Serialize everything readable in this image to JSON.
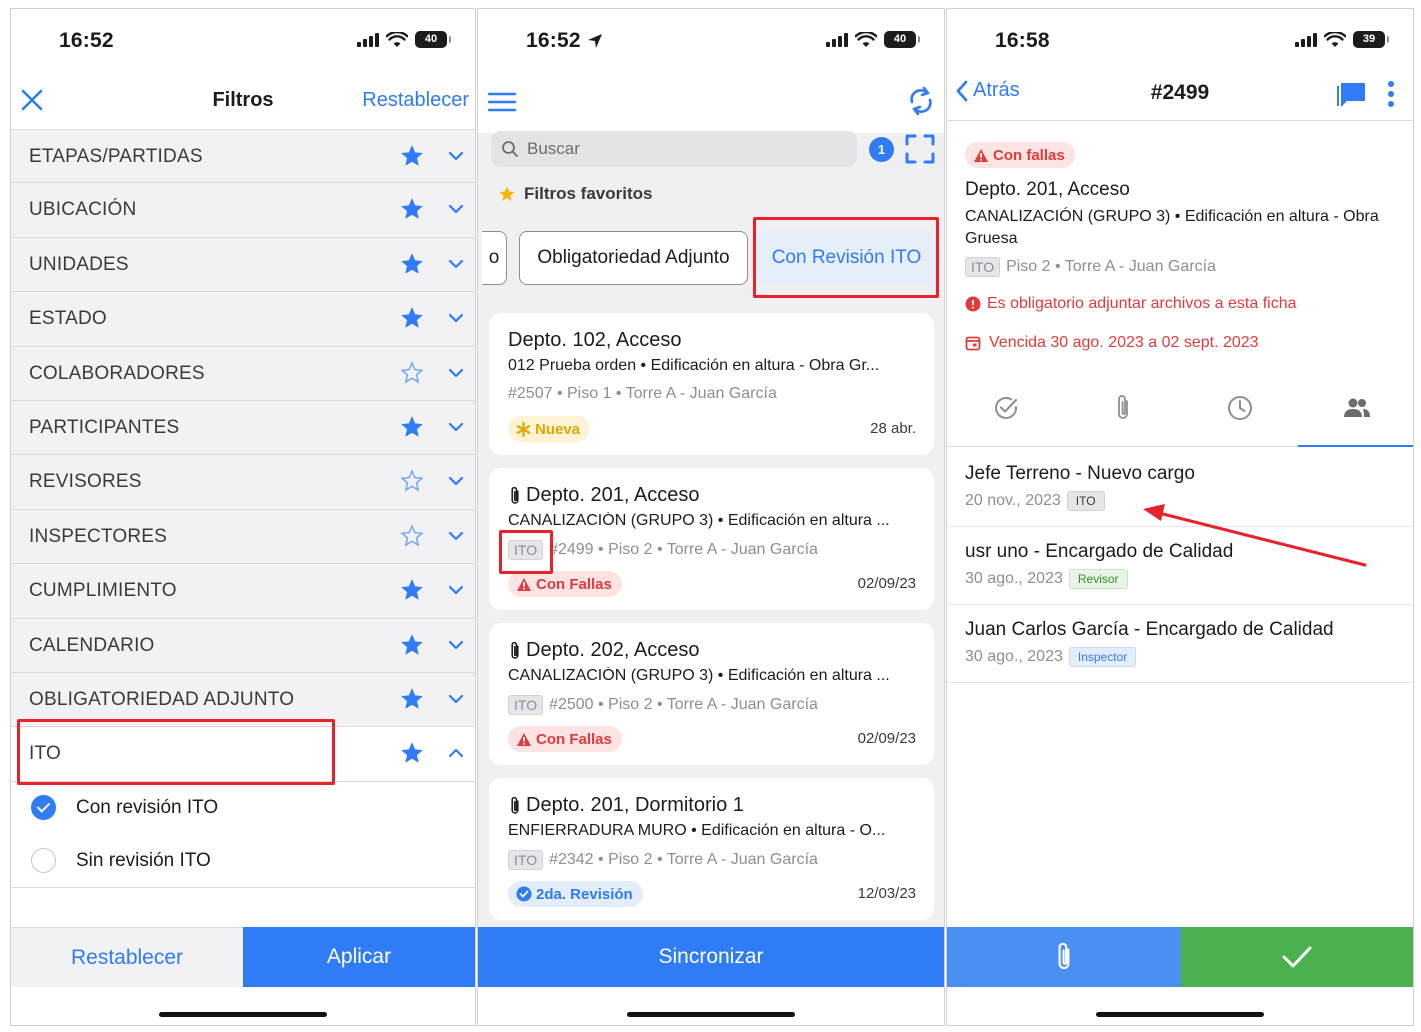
{
  "phones": [
    {
      "status": {
        "time": "16:52",
        "battery": "40"
      },
      "header": {
        "title": "Filtros",
        "reset_label": "Restablecer"
      },
      "filters": [
        {
          "label": "ETAPAS/PARTIDAS",
          "favorite": true
        },
        {
          "label": "UBICACIÓN",
          "favorite": true
        },
        {
          "label": "UNIDADES",
          "favorite": true
        },
        {
          "label": "ESTADO",
          "favorite": true
        },
        {
          "label": "COLABORADORES",
          "favorite": false
        },
        {
          "label": "PARTICIPANTES",
          "favorite": true
        },
        {
          "label": "REVISORES",
          "favorite": false
        },
        {
          "label": "INSPECTORES",
          "favorite": false
        },
        {
          "label": "CUMPLIMIENTO",
          "favorite": true
        },
        {
          "label": "CALENDARIO",
          "favorite": true
        },
        {
          "label": "OBLIGATORIEDAD ADJUNTO",
          "favorite": true
        },
        {
          "label": "ITO",
          "favorite": true,
          "expanded": true
        }
      ],
      "ito_options": [
        {
          "label": "Con revisión ITO",
          "checked": true
        },
        {
          "label": "Sin revisión ITO",
          "checked": false
        }
      ],
      "footer": {
        "reset_label": "Restablecer",
        "apply_label": "Aplicar"
      }
    },
    {
      "status": {
        "time": "16:52",
        "battery": "40"
      },
      "search": {
        "placeholder": "Buscar"
      },
      "filter_count": "1",
      "favorites_title": "Filtros favoritos",
      "chips": [
        {
          "label": "o",
          "active": false
        },
        {
          "label": "Obligatoriedad Adjunto",
          "active": false
        },
        {
          "label": "Con Revisión ITO",
          "active": true
        }
      ],
      "cards": [
        {
          "title": "Depto. 102, Acceso",
          "subtitle": "012 Prueba orden • Edificación en altura - Obra Gr...",
          "tag": "",
          "meta": "#2507 • Piso 1 • Torre A - Juan García",
          "badge": "Nueva",
          "date": "28 abr.",
          "attachment": false
        },
        {
          "title": "Depto. 201, Acceso",
          "subtitle": "CANALIZACIÓN (GRUPO 3) • Edificación en altura ...",
          "tag": "ITO",
          "meta": "#2499 • Piso 2 • Torre A - Juan García",
          "badge": "Con Fallas",
          "date": "02/09/23",
          "attachment": true
        },
        {
          "title": "Depto. 202, Acceso",
          "subtitle": "CANALIZACIÓN (GRUPO 3) • Edificación en altura ...",
          "tag": "ITO",
          "meta": "#2500 • Piso 2 • Torre A - Juan García",
          "badge": "Con Fallas",
          "date": "02/09/23",
          "attachment": true
        },
        {
          "title": "Depto. 201, Dormitorio 1",
          "subtitle": "ENFIERRADURA MURO • Edificación en altura - O...",
          "tag": "ITO",
          "meta": "#2342 • Piso 2 • Torre A - Juan García",
          "badge": "2da. Revisión",
          "date": "12/03/23",
          "attachment": true
        }
      ],
      "footer": {
        "sync_label": "Sincronizar"
      }
    },
    {
      "status": {
        "time": "16:58",
        "battery": "39"
      },
      "header": {
        "back_label": "Atrás",
        "title": "#2499"
      },
      "detail": {
        "status_pill": "Con fallas",
        "location": "Depto. 201, Acceso",
        "description": "CANALIZACIÓN (GRUPO 3) • Edificación en altura - Obra Gruesa",
        "tag": "ITO",
        "meta": "Piso 2 • Torre A - Juan García",
        "warning": "Es obligatorio adjuntar archivos a esta ficha",
        "due": "Vencida 30 ago. 2023 a 02 sept. 2023"
      },
      "participants": [
        {
          "name": "Jefe Terreno - Nuevo cargo",
          "date": "20 nov., 2023",
          "role": "ITO"
        },
        {
          "name": "usr uno - Encargado de Calidad",
          "date": "30 ago., 2023",
          "role": "Revisor"
        },
        {
          "name": "Juan Carlos García - Encargado de Calidad",
          "date": "30 ago., 2023",
          "role": "Inspector"
        }
      ]
    }
  ],
  "colors": {
    "accent": "#2f7cf6",
    "danger": "#e23b3b",
    "success": "#4caf50",
    "highlight": "#e8212a"
  }
}
